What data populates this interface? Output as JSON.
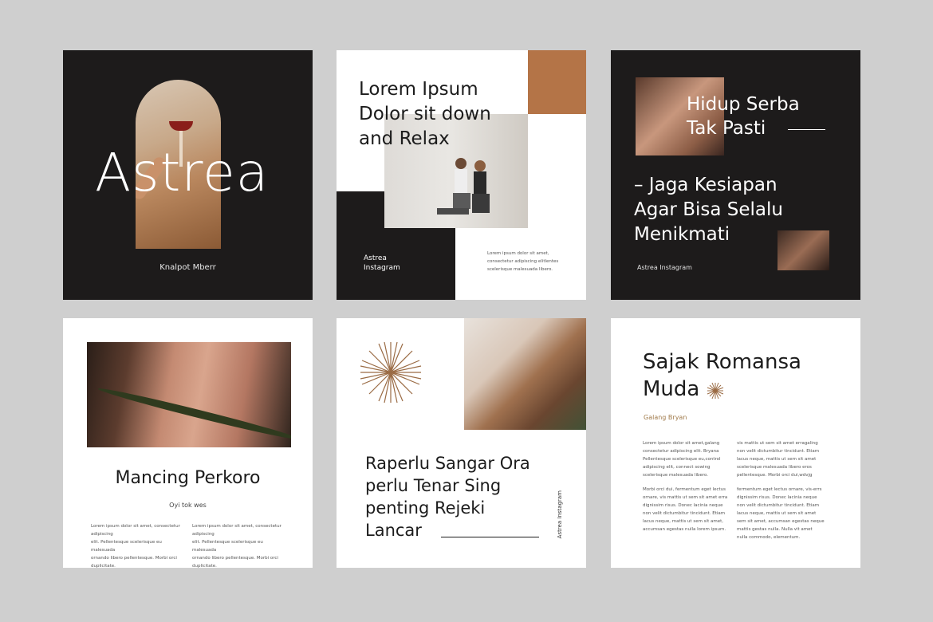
{
  "colors": {
    "background": "#cfcfcf",
    "dark": "#1d1b1b",
    "accent_brown": "#b47447",
    "author": "#a07a4a"
  },
  "card1": {
    "title": "Astrea",
    "subtitle": "Knalpot Mberr"
  },
  "card2": {
    "title_lines": [
      "Lorem Ipsum",
      "Dolor sit down",
      "and Relax"
    ],
    "brand_lines": [
      "Astrea",
      "Instagram"
    ],
    "body_lines": [
      "Lorem ipsum dolor sit amet,",
      "consectetur adipiscing elitlentes",
      "scelerisque malesuada libero."
    ]
  },
  "card3": {
    "heading_lines": [
      "Hidup Serba",
      "Tak Pasti"
    ],
    "body_lines": [
      "– Jaga Kesiapan",
      "Agar Bisa Selalu",
      "Menikmati"
    ],
    "brand": "Astrea Instagram"
  },
  "card4": {
    "title": "Mancing Perkoro",
    "subtitle": "Oyi tok wes",
    "col1_lines": [
      "Lorem ipsum dolor sit amet, consectetur adipiscing",
      "elit. Pellentesque scelerisque eu malesuada",
      "ornando libero pellentesque. Morbi orci duplicitate."
    ],
    "col2_lines": [
      "Lorem ipsum dolor sit amet, consectetur adipiscing",
      "elit. Pellentesque scelerisque eu malesuada",
      "ornando libero pellentesque. Morbi orci duplicitate."
    ]
  },
  "card5": {
    "title_lines": [
      "Raperlu Sangar Ora",
      "perlu Tenar Sing",
      "penting Rejeki",
      "Lancar"
    ],
    "vertical": "Astrea Instagram"
  },
  "card6": {
    "title_lines": [
      "Sajak Romansa",
      "Muda"
    ],
    "author": "Galang Bryan",
    "col1_p1": [
      "Lorem ipsum dolor sit amet,galang",
      "consectetur adipiscing elit. Bryana",
      "Pellentesque scelerisque eu,control",
      "adipiscing elit, connect sowing",
      "scelerisque malesuada libero."
    ],
    "col1_p2": [
      "Morbi orci dui, fermentum eget lectus",
      "ornare, vis mattis ut sem sit amet erra",
      "dignissim risus. Donec lacinia neque",
      "non velit dictumbitur tincidunt. Etiam",
      "lacus neque, mattis ut sem sit amet,",
      "accumsan egestas nulla lorem ipsum."
    ],
    "col2_p1": [
      "vis mattis ut sem sit amet erragaling",
      "non velit dictumbitur tincidunt. Etiam",
      "lacus neque, mattis ut sem sit amet",
      "scelerisque malesuada libero eros",
      "pellentesque. Morbi orci dui,wdvjg"
    ],
    "col2_p2": [
      "fermentum eget lectus ornare, vis-errs",
      "dignissim risus. Donec lacinia neque",
      "non velit dictumbitur tincidunt. Etiam",
      "lacus neque, mattis ut sem sit amet",
      "sem sit amet, accumsan egestas neque",
      "mattis gestas nulla. Nulla vit amet",
      "nulla commodo, elementum."
    ]
  }
}
